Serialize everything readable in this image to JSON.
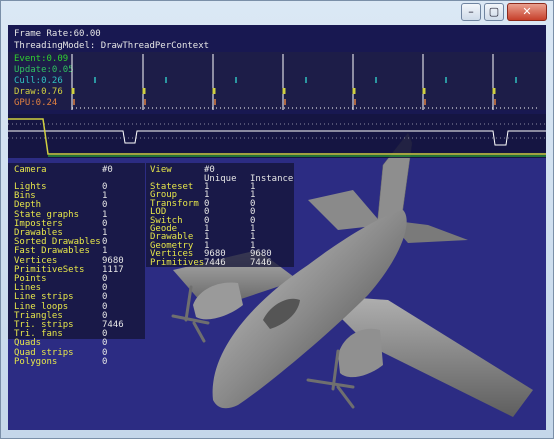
{
  "window": {
    "title": "",
    "buttons": [
      {
        "name": "minimize-button",
        "label": "–"
      },
      {
        "name": "maximize-button",
        "label": "▢"
      },
      {
        "name": "close-button",
        "label": "✕"
      }
    ]
  },
  "stats": {
    "frame_rate": "Frame Rate:60.00",
    "threading": "ThreadingModel: DrawThreadPerContext",
    "event": "Event:0.09",
    "update": "Update:0.05",
    "cull": "Cull:0.26",
    "draw": "Draw:0.76",
    "gpu": "GPU:0.24",
    "colors": {
      "event": "#30d030",
      "update": "#30c060",
      "cull": "#30c0c0",
      "draw": "#d0d040",
      "gpu": "#e08040"
    }
  },
  "camera": {
    "header": "Camera",
    "id": "#0",
    "rows": [
      {
        "label": "Lights",
        "value": "0"
      },
      {
        "label": "Bins",
        "value": "1"
      },
      {
        "label": "Depth",
        "value": "0"
      },
      {
        "label": "State graphs",
        "value": "1"
      },
      {
        "label": "Imposters",
        "value": "0"
      },
      {
        "label": "Drawables",
        "value": "1"
      },
      {
        "label": "Sorted Drawables",
        "value": "0"
      },
      {
        "label": "Fast Drawables",
        "value": "1"
      },
      {
        "label": "Vertices",
        "value": "9680"
      },
      {
        "label": "PrimitiveSets",
        "value": "1117"
      },
      {
        "label": "Points",
        "value": "0"
      },
      {
        "label": "Lines",
        "value": "0"
      },
      {
        "label": "Line strips",
        "value": "0"
      },
      {
        "label": "Line loops",
        "value": "0"
      },
      {
        "label": "Triangles",
        "value": "0"
      },
      {
        "label": "Tri. strips",
        "value": "7446"
      },
      {
        "label": "Tri. fans",
        "value": "0"
      },
      {
        "label": "Quads",
        "value": "0"
      },
      {
        "label": "Quad strips",
        "value": "0"
      },
      {
        "label": "Polygons",
        "value": "0"
      }
    ]
  },
  "view": {
    "header": "View",
    "id": "#0",
    "col_unique": "Unique",
    "col_instance": "Instance",
    "rows": [
      {
        "label": "Stateset",
        "unique": "1",
        "instance": "1"
      },
      {
        "label": "Group",
        "unique": "1",
        "instance": "1"
      },
      {
        "label": "Transform",
        "unique": "0",
        "instance": "0"
      },
      {
        "label": "LOD",
        "unique": "0",
        "instance": "0"
      },
      {
        "label": "Switch",
        "unique": "0",
        "instance": "0"
      },
      {
        "label": "Geode",
        "unique": "1",
        "instance": "1"
      },
      {
        "label": "Drawable",
        "unique": "1",
        "instance": "1"
      },
      {
        "label": "Geometry",
        "unique": "1",
        "instance": "1"
      },
      {
        "label": "Vertices",
        "unique": "9680",
        "instance": "9680"
      },
      {
        "label": "Primitives",
        "unique": "7446",
        "instance": "7446"
      }
    ]
  }
}
